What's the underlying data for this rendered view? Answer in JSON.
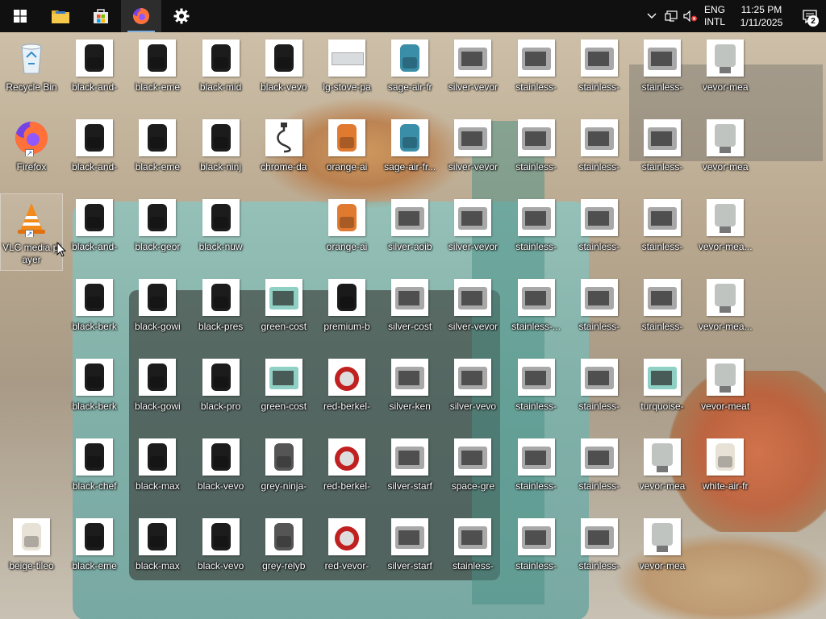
{
  "taskbar": {
    "start_icon": "windows-logo-icon",
    "pinned": [
      {
        "name": "file-explorer",
        "icon": "folder-icon"
      },
      {
        "name": "microsoft-store",
        "icon": "store-icon"
      },
      {
        "name": "firefox",
        "icon": "firefox-icon",
        "active": true
      },
      {
        "name": "settings",
        "icon": "gear-icon"
      }
    ],
    "tray": {
      "chevron": "˄",
      "language_line1": "ENG",
      "language_line2": "INTL",
      "time": "11:25 PM",
      "date": "1/11/2025",
      "notification_count": "2"
    }
  },
  "desktop": {
    "columns": [
      [
        "Recycle Bin",
        "Firefox",
        "VLC media player",
        "",
        "",
        "",
        "beige-tileo"
      ],
      [
        "black-and-",
        "black-and-",
        "black-and-",
        "black-berk",
        "black-berk",
        "black-chef",
        "black-eme"
      ],
      [
        "black-eme",
        "black-eme",
        "black-geor",
        "black-gowi",
        "black-gowi",
        "black-max",
        "black-max"
      ],
      [
        "black-mid",
        "black-ninj",
        "black-nuw",
        "black-pres",
        "black-pro",
        "black-vevo",
        "black-vevo"
      ],
      [
        "black-vevo",
        "chrome-da",
        "",
        "green-cost",
        "green-cost",
        "grey-ninja-",
        "grey-relyb"
      ],
      [
        "lg-stove-pa",
        "orange-ai",
        "orange-ai",
        "premium-b",
        "red-berkel-",
        "red-berkel-",
        "red-vevor-"
      ],
      [
        "sage-air-fr",
        "sage-air-fr...",
        "silver-aoib",
        "silver-cost",
        "silver-ken",
        "silver-starf",
        "silver-starf"
      ],
      [
        "silver-vevor",
        "silver-vevor",
        "silver-vevor",
        "silver-vevor",
        "silver-vevo",
        "space-gre",
        "stainless-"
      ],
      [
        "stainless-",
        "stainless-",
        "stainless-",
        "stainless-...",
        "stainless-",
        "stainless-",
        "stainless-"
      ],
      [
        "stainless-",
        "stainless-",
        "stainless-",
        "stainless-",
        "stainless-",
        "stainless-",
        "stainless-"
      ],
      [
        "stainless-",
        "stainless-",
        "stainless-",
        "stainless-",
        "turquoise-",
        "vevor-mea",
        "vevor-mea"
      ],
      [
        "vevor-mea",
        "vevor-mea",
        "vevor-mea...",
        "vevor-mea...",
        "vevor-meat",
        "white-air-fr",
        ""
      ]
    ]
  },
  "colors": {
    "taskbar": "#101010",
    "desktop_label": "#ffffff"
  }
}
